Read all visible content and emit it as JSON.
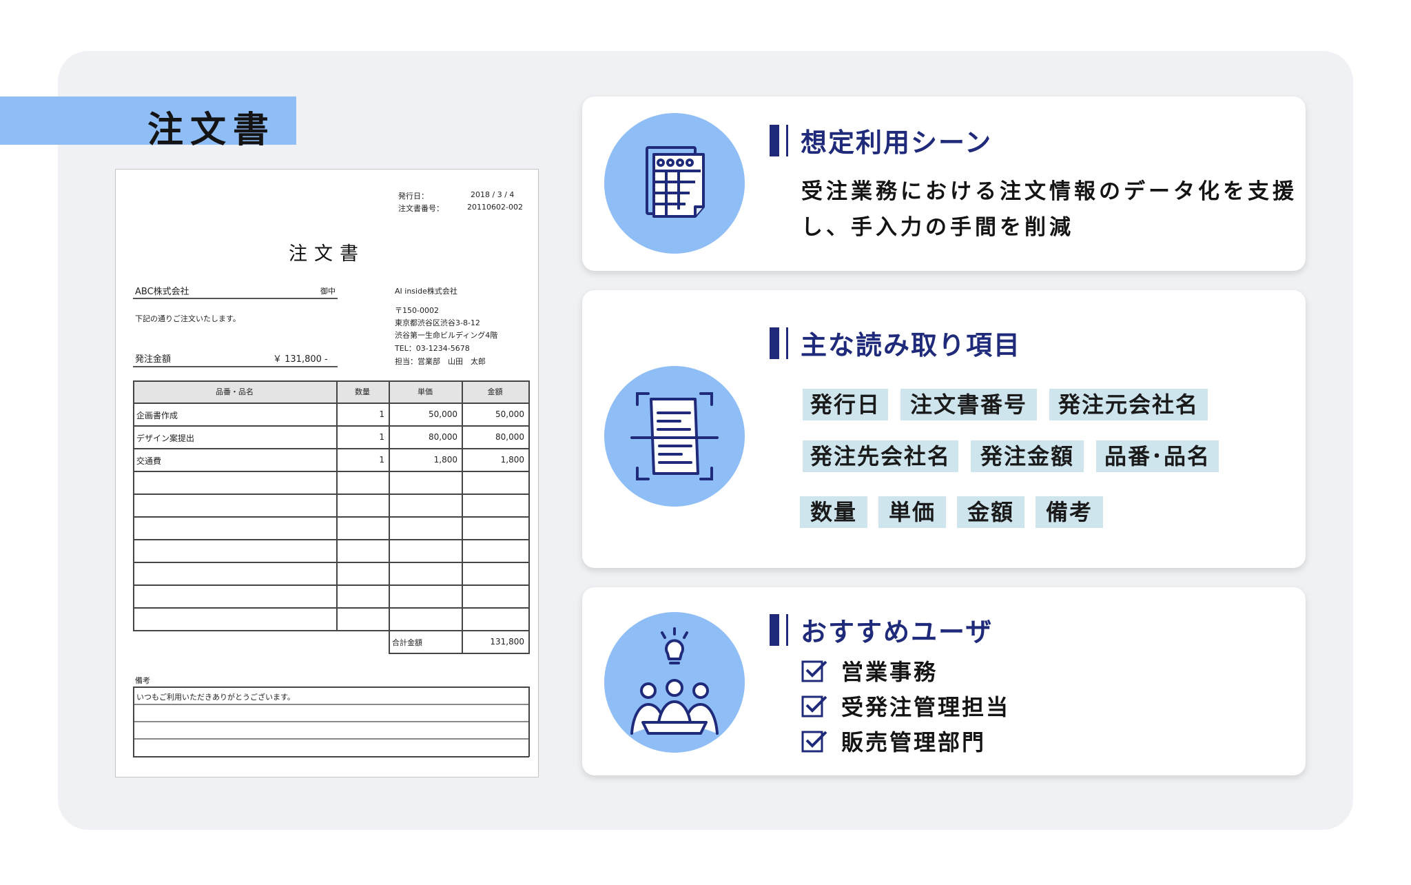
{
  "heading_tag": "注文書",
  "document": {
    "issue_date_label": "発行日：",
    "issue_date_value": "2018 / 3 / 4",
    "order_no_label": "注文書番号：",
    "order_no_value": "20110602-002",
    "title": "注文書",
    "customer_name": "ABC株式会社",
    "honorific": "御中",
    "intro_text": "下記の通りご注文いたします。",
    "order_amount_label": "発注金額",
    "order_amount_value": "￥  131,800 -",
    "sender_company": "AI inside株式会社",
    "sender_postal": "〒150-0002",
    "sender_address1": "東京都渋谷区渋谷3-8-12",
    "sender_address2": "渋谷第一生命ビルディング4階",
    "sender_tel": "TEL：03-1234-5678",
    "sender_person": "担当：営業部　山田　太郎",
    "table_headers": [
      "品番・品名",
      "数量",
      "単価",
      "金額"
    ],
    "rows": [
      {
        "name": "企画書作成",
        "qty": "1",
        "price": "50,000",
        "amount": "50,000"
      },
      {
        "name": "デザイン案提出",
        "qty": "1",
        "price": "80,000",
        "amount": "80,000"
      },
      {
        "name": "交通費",
        "qty": "1",
        "price": "1,800",
        "amount": "1,800"
      }
    ],
    "total_label": "合計金額",
    "total_value": "131,800",
    "remarks_label": "備考",
    "remarks_text": "いつもご利用いただきありがとうございます。"
  },
  "cards": {
    "scene": {
      "title": "想定利用シーン",
      "description": "受注業務における注文情報のデータ化を支援し、手入力の手間を削減",
      "icon": "spreadsheet-document-icon"
    },
    "fields": {
      "title": "主な読み取り項目",
      "icon": "document-scan-icon",
      "chips": [
        "発行日",
        "注文書番号",
        "発注元会社名",
        "発注先会社名",
        "発注金額",
        "品番･品名",
        "数量",
        "単価",
        "金額",
        "備考"
      ]
    },
    "users": {
      "title": "おすすめユーザ",
      "icon": "team-idea-icon",
      "items": [
        "営業事務",
        "受発注管理担当",
        "販売管理部門"
      ]
    }
  },
  "colors": {
    "accent_navy": "#1f2a7a",
    "circle_blue": "#8fbdf6",
    "chip_bg": "#cfe5ee",
    "panel_bg": "#eff1f4"
  }
}
